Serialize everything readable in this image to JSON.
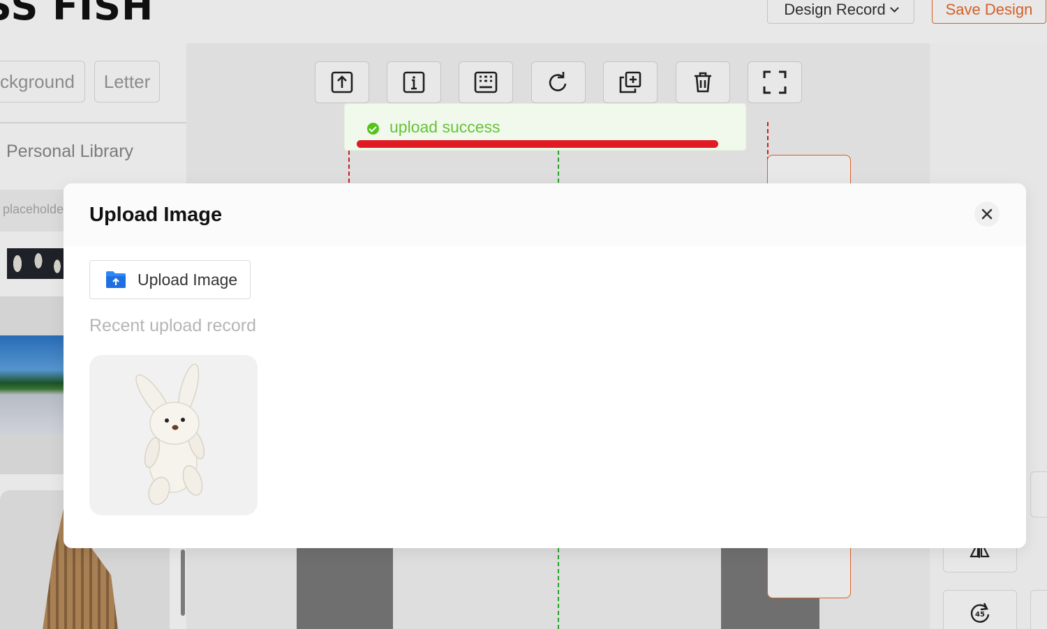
{
  "app": {
    "brand": "SS FISH",
    "header": {
      "design_record_label": "Design Record",
      "save_design_label": "Save Design"
    },
    "sidebar": {
      "tabs": [
        "ckground",
        "Letter"
      ],
      "section_title": "Personal Library",
      "search_placeholder": "placeholder"
    }
  },
  "toolbar": {
    "tools": [
      "upload-icon",
      "info-icon",
      "keyboard-icon",
      "refresh-icon",
      "duplicate-icon",
      "trash-icon",
      "fullscreen-icon"
    ]
  },
  "toast": {
    "message": "upload success",
    "status_color": "#67c23a"
  },
  "modal": {
    "title": "Upload Image",
    "upload_button_label": "Upload Image",
    "recent_label": "Recent upload record",
    "recent_items": [
      {
        "name": "white-plush-bunny"
      }
    ]
  },
  "colors": {
    "accent": "#ea6a2c",
    "success": "#52c41a",
    "highlight_underline": "#e01b24",
    "guide_red": "#e02020",
    "guide_green": "#2ab32a"
  }
}
